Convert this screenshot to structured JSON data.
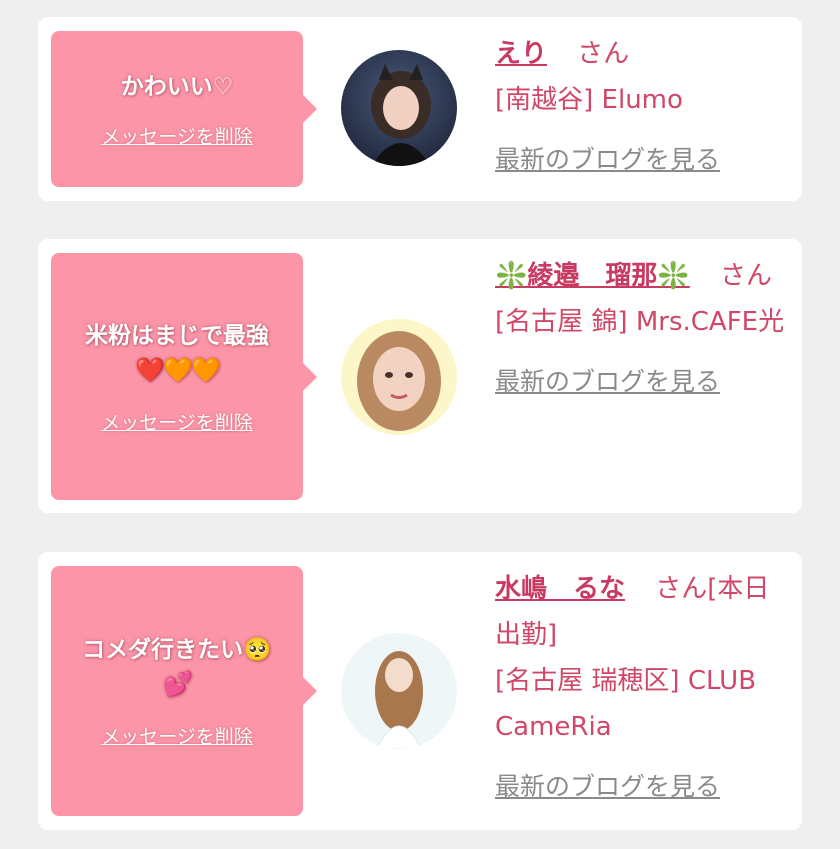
{
  "entries": [
    {
      "message": "かわいい♡",
      "emoji": "",
      "delete_label": "メッセージを削除",
      "name": "えり",
      "suffix": "さん",
      "shop": "[南越谷] Elumo",
      "blog_label": "最新のブログを見る"
    },
    {
      "message": "米粉はまじで最強",
      "emoji": "❤️🧡🧡",
      "delete_label": "メッセージを削除",
      "name": "❇️綾邉　瑠那❇️",
      "suffix": "さん",
      "shop": "[名古屋 錦] Mrs.CAFE光",
      "blog_label": "最新のブログを見る"
    },
    {
      "message": "コメダ行きたい🥺",
      "emoji": "💕",
      "delete_label": "メッセージを削除",
      "name": "水嶋　るな",
      "suffix": "さん[本日出勤]",
      "shop": "[名古屋 瑞穂区] CLUB CameRia",
      "blog_label": "最新のブログを見る"
    }
  ]
}
